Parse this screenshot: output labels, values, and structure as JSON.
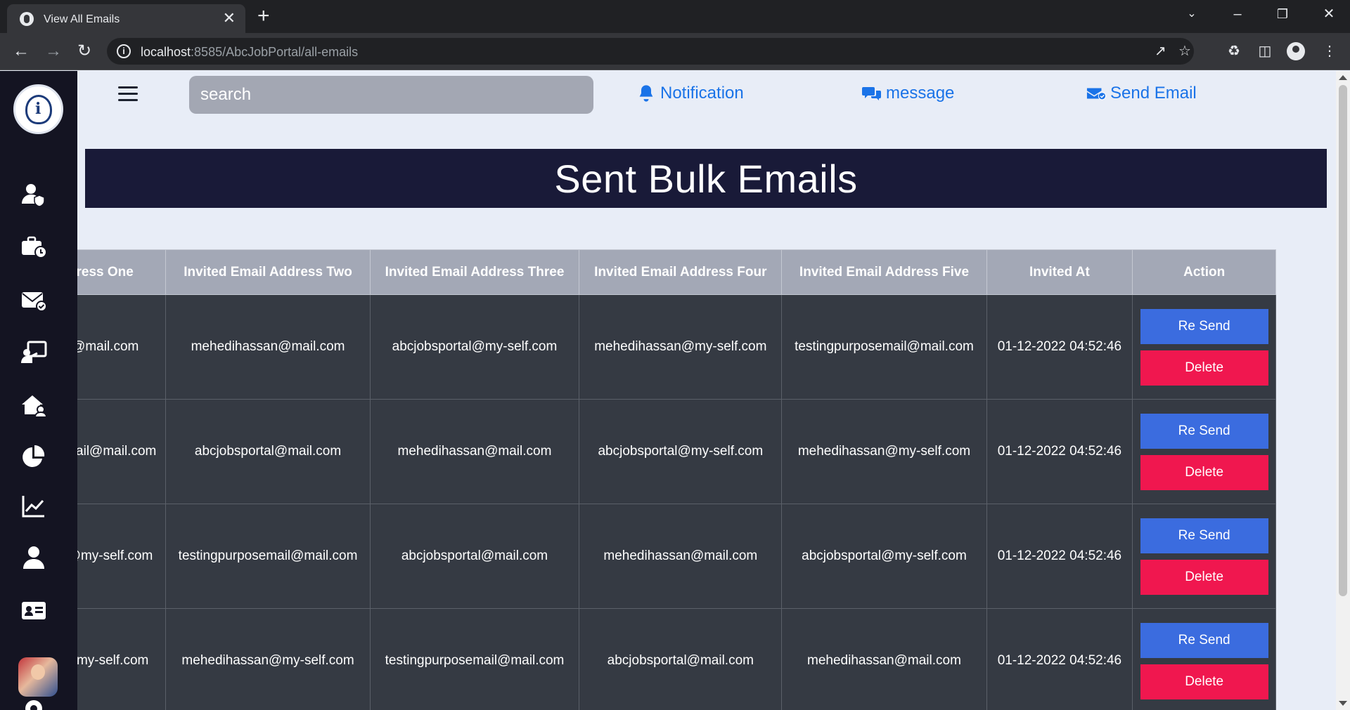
{
  "browser": {
    "tab_title": "View All Emails",
    "tab_close": "✕",
    "new_tab": "+",
    "url_host": "localhost",
    "url_path": ":8585/AbcJobPortal/all-emails"
  },
  "header": {
    "search_placeholder": "search",
    "notification_label": "Notification",
    "message_label": "message",
    "send_email_label": "Send Email"
  },
  "sidebar": {
    "icons": [
      "user-shield-icon",
      "briefcase-clock-icon",
      "envelope-check-icon",
      "chalkboard-user-icon",
      "house-user-icon",
      "pie-chart-icon",
      "line-chart-icon",
      "user-icon",
      "id-card-icon",
      "settings-icon"
    ]
  },
  "page": {
    "title": "Sent Bulk Emails"
  },
  "table": {
    "columns": [
      "Address One",
      "Invited Email Address Two",
      "Invited Email Address Three",
      "Invited Email Address Four",
      "Invited Email Address Five",
      "Invited At",
      "Action"
    ],
    "rows": [
      [
        "l@mail.com",
        "mehedihassan@mail.com",
        "abcjobsportal@my-self.com",
        "mehedihassan@my-self.com",
        "testingpurposemail@mail.com",
        "01-12-2022 04:52:46"
      ],
      [
        "nail@mail.com",
        "abcjobsportal@mail.com",
        "mehedihassan@mail.com",
        "abcjobsportal@my-self.com",
        "mehedihassan@my-self.com",
        "01-12-2022 04:52:46"
      ],
      [
        "@my-self.com",
        "testingpurposemail@mail.com",
        "abcjobsportal@mail.com",
        "mehedihassan@mail.com",
        "abcjobsportal@my-self.com",
        "01-12-2022 04:52:46"
      ],
      [
        "@my-self.com",
        "mehedihassan@my-self.com",
        "testingpurposemail@mail.com",
        "abcjobsportal@mail.com",
        "mehedihassan@mail.com",
        "01-12-2022 04:52:46"
      ]
    ],
    "resend_label": "Re Send",
    "delete_label": "Delete"
  },
  "colors": {
    "accent": "#1a73e8",
    "banner": "#191a38",
    "resend": "#3b6cdf",
    "delete": "#f0174f"
  }
}
